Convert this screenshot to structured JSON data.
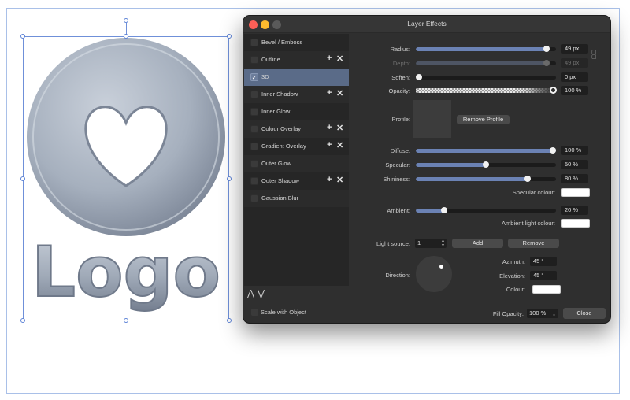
{
  "canvas": {
    "logo_text": "Logo"
  },
  "dialog": {
    "title": "Layer Effects",
    "effects": [
      {
        "label": "Bevel / Emboss",
        "checked": false,
        "has_add_remove": false
      },
      {
        "label": "Outline",
        "checked": false,
        "has_add_remove": true
      },
      {
        "label": "3D",
        "checked": true,
        "has_add_remove": false
      },
      {
        "label": "Inner Shadow",
        "checked": false,
        "has_add_remove": true
      },
      {
        "label": "Inner Glow",
        "checked": false,
        "has_add_remove": false
      },
      {
        "label": "Colour Overlay",
        "checked": false,
        "has_add_remove": true
      },
      {
        "label": "Gradient Overlay",
        "checked": false,
        "has_add_remove": true
      },
      {
        "label": "Outer Glow",
        "checked": false,
        "has_add_remove": false
      },
      {
        "label": "Outer Shadow",
        "checked": false,
        "has_add_remove": true
      },
      {
        "label": "Gaussian Blur",
        "checked": false,
        "has_add_remove": false
      }
    ],
    "plus_glyph": "+",
    "x_glyph": "✕",
    "check_glyph": "✓",
    "move_up_glyph": "⋀",
    "move_down_glyph": "⋁",
    "scale_with_object_label": "Scale with Object",
    "params": {
      "radius": {
        "label": "Radius:",
        "value": "49 px",
        "level": 0.93
      },
      "depth": {
        "label": "Depth:",
        "value": "49 px",
        "level": 0.93
      },
      "soften": {
        "label": "Soften:",
        "value": "0 px",
        "level": 0.0
      },
      "opacity": {
        "label": "Opacity:",
        "value": "100 %",
        "level": 1.0
      },
      "profile": {
        "label": "Profile:",
        "remove_label": "Remove Profile"
      },
      "diffuse": {
        "label": "Diffuse:",
        "value": "100 %",
        "level": 1.0
      },
      "specular": {
        "label": "Specular:",
        "value": "50 %",
        "level": 0.5
      },
      "shininess": {
        "label": "Shininess:",
        "value": "80 %",
        "level": 0.8
      },
      "specular_colour": {
        "label": "Specular colour:",
        "color": "#ffffff"
      },
      "ambient": {
        "label": "Ambient:",
        "value": "20 %",
        "level": 0.2
      },
      "ambient_light_colour": {
        "label": "Ambient light colour:",
        "color": "#ffffff"
      },
      "light_source": {
        "label": "Light source:",
        "value": "1",
        "add_label": "Add",
        "remove_label": "Remove"
      },
      "direction": {
        "label": "Direction:"
      },
      "azimuth": {
        "label": "Azimuth:",
        "value": "45 °"
      },
      "elevation": {
        "label": "Elevation:",
        "value": "45 °"
      },
      "colour": {
        "label": "Colour:",
        "color": "#ffffff"
      }
    },
    "fill_opacity": {
      "label": "Fill Opacity:",
      "value": "100 %"
    },
    "close_label": "Close"
  },
  "colors": {
    "accent": "#6b82b4",
    "selected_row": "#5a6b88",
    "dialog_bg": "#2f2f2f"
  }
}
